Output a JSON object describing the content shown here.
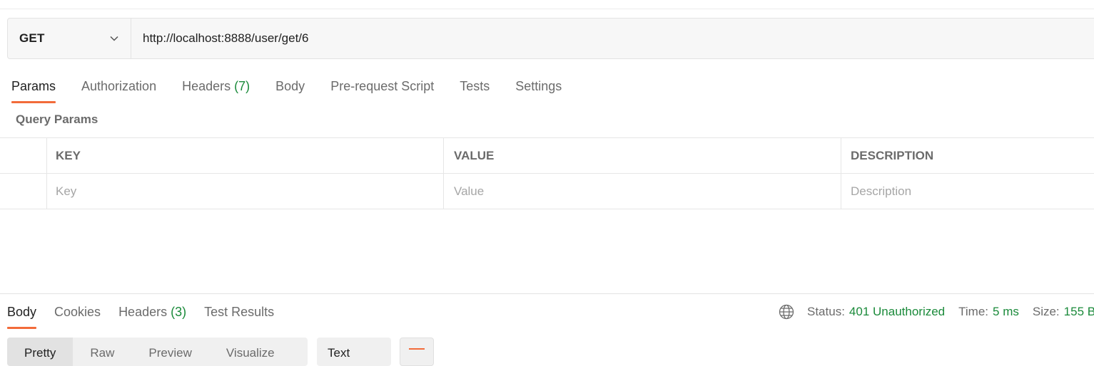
{
  "request": {
    "method": "GET",
    "url": "http://localhost:8888/user/get/6"
  },
  "request_tabs": [
    {
      "label": "Params",
      "active": true
    },
    {
      "label": "Authorization"
    },
    {
      "label": "Headers",
      "count": "(7)"
    },
    {
      "label": "Body"
    },
    {
      "label": "Pre-request Script"
    },
    {
      "label": "Tests"
    },
    {
      "label": "Settings"
    }
  ],
  "query_params": {
    "title": "Query Params",
    "headers": {
      "key": "KEY",
      "value": "VALUE",
      "description": "DESCRIPTION"
    },
    "placeholders": {
      "key": "Key",
      "value": "Value",
      "description": "Description"
    }
  },
  "response_tabs": [
    {
      "label": "Body",
      "active": true
    },
    {
      "label": "Cookies"
    },
    {
      "label": "Headers",
      "count": "(3)"
    },
    {
      "label": "Test Results"
    }
  ],
  "response_status": {
    "status_label": "Status:",
    "status_value": "401 Unauthorized",
    "time_label": "Time:",
    "time_value": "5 ms",
    "size_label": "Size:",
    "size_value": "155 B"
  },
  "body_format": {
    "modes": [
      "Pretty",
      "Raw",
      "Preview",
      "Visualize"
    ],
    "selected_mode": "Pretty",
    "language": "Text"
  },
  "colors": {
    "accent": "#f26b3a",
    "success": "#1a8a3a"
  }
}
